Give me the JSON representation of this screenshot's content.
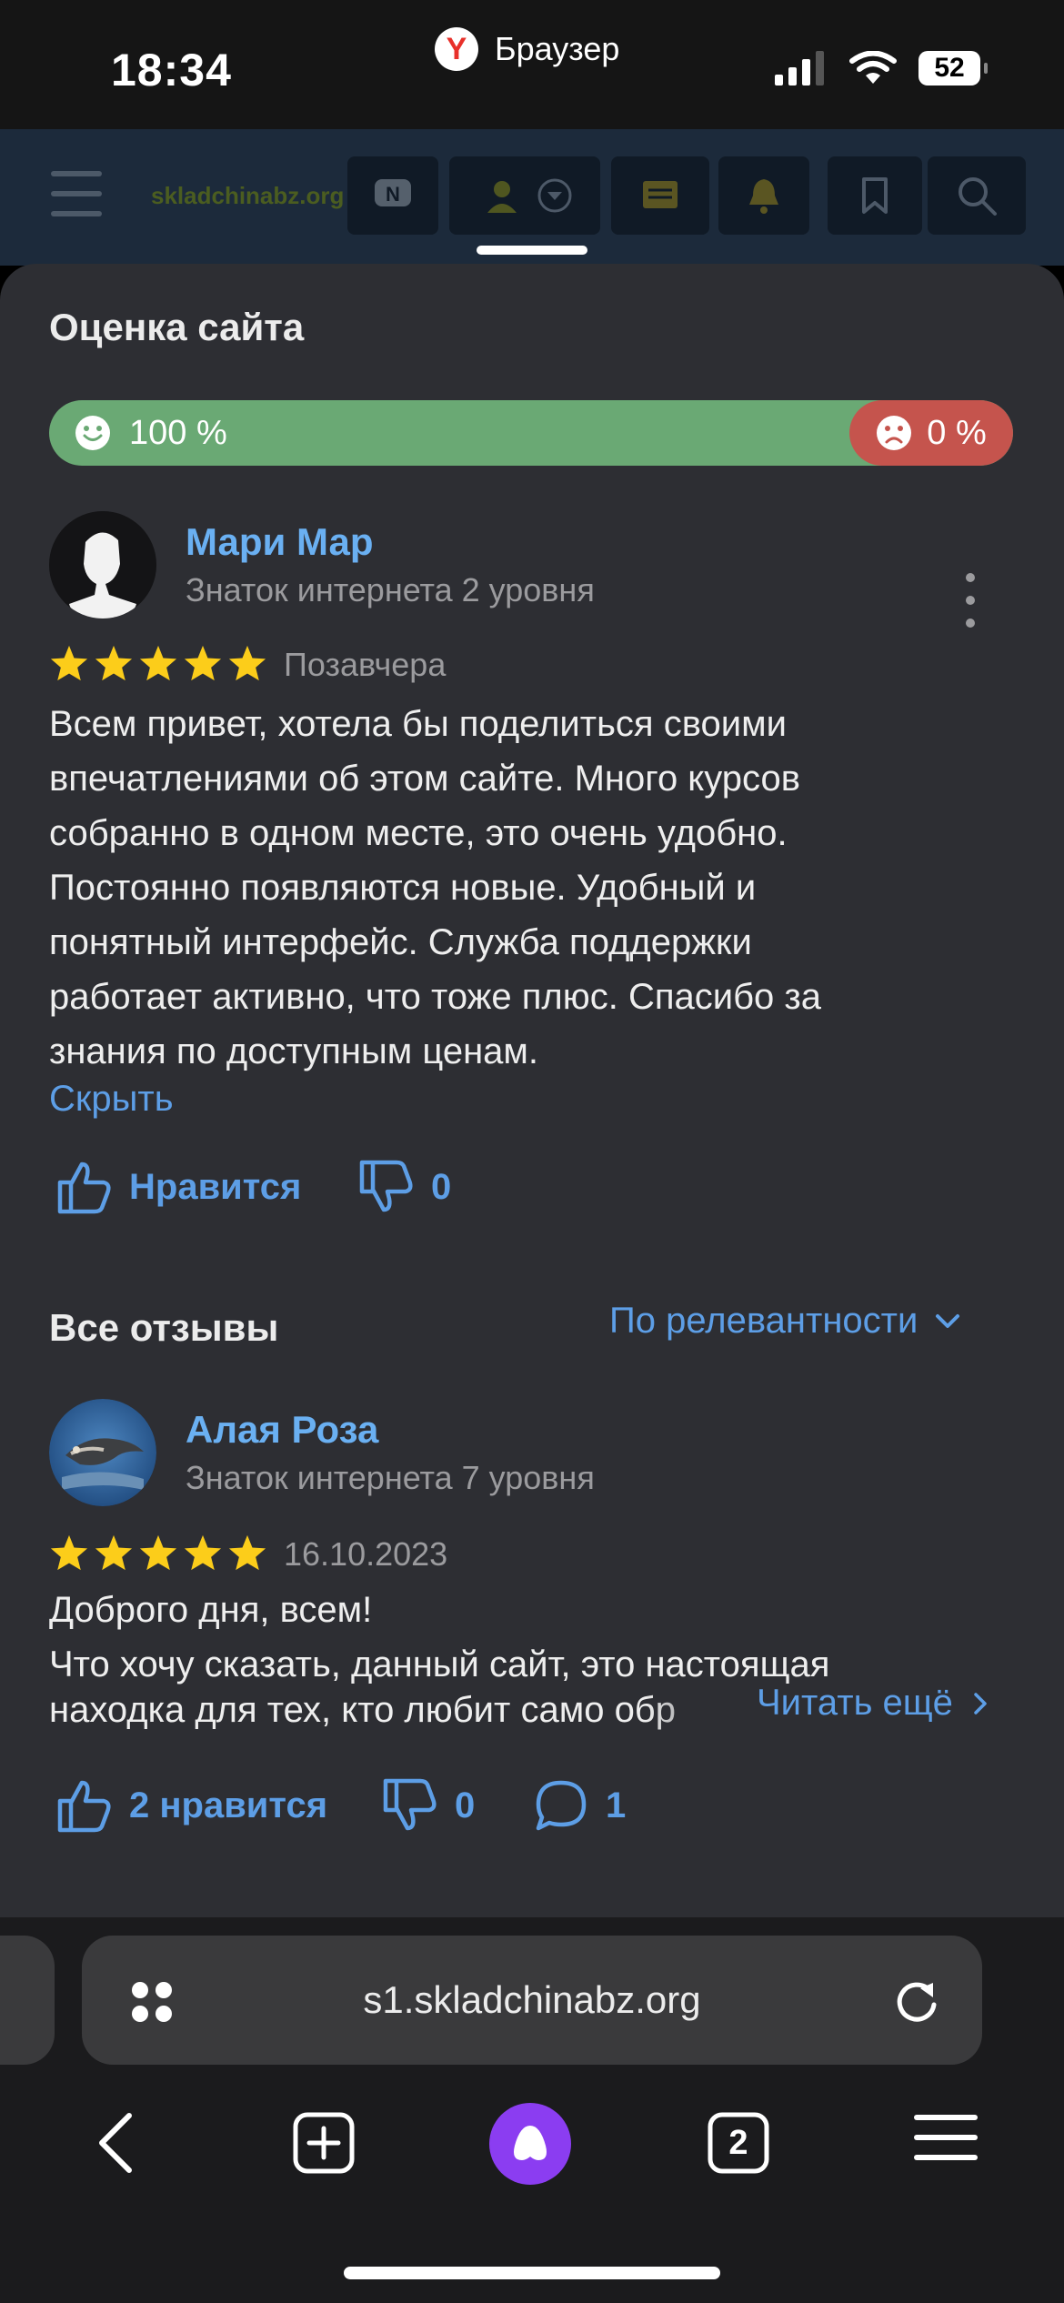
{
  "status": {
    "time": "18:34",
    "app": "Браузер",
    "battery": "52"
  },
  "site": {
    "logo": "skladchinabz.org"
  },
  "rating": {
    "title": "Оценка сайта",
    "positive": "100 %",
    "negative": "0 %",
    "positive_fraction": 1.0,
    "colors": {
      "positive": "#6aa974",
      "negative": "#c5544d"
    }
  },
  "review1": {
    "name": "Мари Мар",
    "level": "Знаток интернета 2 уровня",
    "stars": 5,
    "date": "Позавчера",
    "lines": [
      "Всем привет, хотела бы поделиться своими",
      "впечатлениями об этом сайте. Много курсов",
      "собранно в одном месте, это очень удобно.",
      "Постоянно появляются новые. Удобный и",
      "понятный интерфейс. Служба поддержки",
      "работает активно, что тоже плюс. Спасибо за",
      "знания по доступным ценам."
    ],
    "collapse": "Скрыть",
    "like": "Нравится",
    "dislike_count": "0"
  },
  "all_reviews": {
    "title": "Все отзывы",
    "sort": "По релевантности"
  },
  "review2": {
    "name": "Алая Роза",
    "level": "Знаток интернета 7 уровня",
    "stars": 5,
    "date": "16.10.2023",
    "line1": "Доброго дня, всем!",
    "line2": "Что хочу сказать, данный сайт, это настоящая",
    "line3": "находка для тех, кто любит само обр",
    "read_more": "Читать ещё",
    "likes": "2 нравится",
    "dislike_count": "0",
    "comments": "1"
  },
  "browser": {
    "url": "s1.skladchinabz.org",
    "tabs": "2"
  }
}
